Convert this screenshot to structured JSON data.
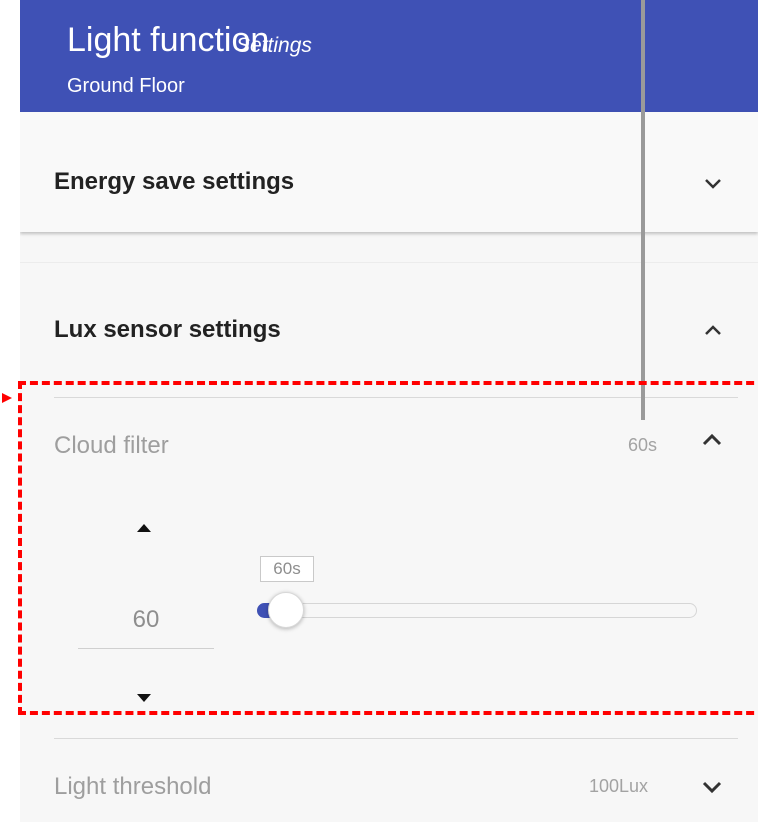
{
  "header": {
    "title": "Light function",
    "subtitle": "Settings",
    "floor": "Ground Floor",
    "background_color": "#3f51b5"
  },
  "sections": {
    "energy": {
      "label": "Energy save settings",
      "icon": "chevron-down-icon",
      "expanded": false
    },
    "lux": {
      "label": "Lux sensor settings",
      "icon": "chevron-up-icon",
      "expanded": true
    }
  },
  "cloud_filter": {
    "label": "Cloud filter",
    "value_display": "60s",
    "expanded": true,
    "number_value": "60",
    "slider_tooltip": "60s",
    "increment_icon": "triangle-up-icon",
    "decrement_icon": "triangle-down-icon"
  },
  "light_threshold": {
    "label": "Light threshold",
    "value_display": "100Lux",
    "expanded": false
  },
  "annotation": {
    "highlight_color": "#ff0000"
  }
}
